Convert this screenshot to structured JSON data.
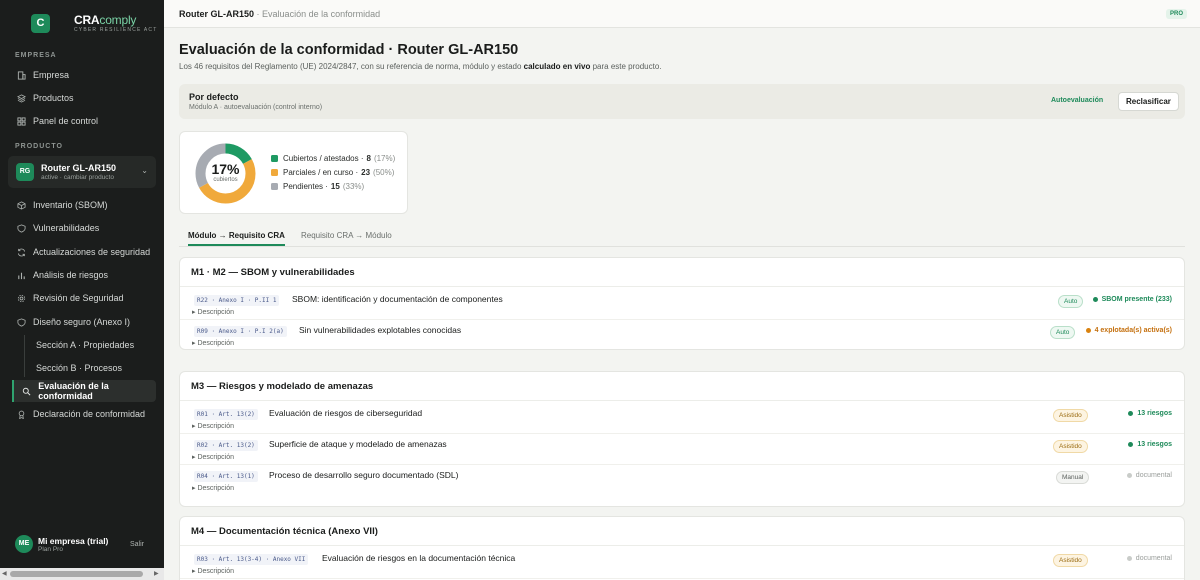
{
  "brand": {
    "logo_letter": "C",
    "name_main": "CRA",
    "name_accent": "comply",
    "tagline": "CYBER RESILIENCE ACT"
  },
  "sidebar": {
    "section_company": "EMPRESA",
    "company_items": [
      {
        "label": "Empresa",
        "icon": "building-icon"
      },
      {
        "label": "Productos",
        "icon": "layers-icon"
      },
      {
        "label": "Panel de control",
        "icon": "grid-icon"
      }
    ],
    "section_product": "PRODUCTO",
    "product": {
      "initials": "RG",
      "name": "Router GL-AR150",
      "sub": "active · cambiar producto"
    },
    "product_items": [
      {
        "label": "Inventario (SBOM)",
        "icon": "box-icon"
      },
      {
        "label": "Vulnerabilidades",
        "icon": "shield-icon"
      },
      {
        "label": "Actualizaciones de seguridad",
        "icon": "refresh-icon"
      },
      {
        "label": "Análisis de riesgos",
        "icon": "bar-chart-icon"
      },
      {
        "label": "Revisión de Seguridad",
        "icon": "gear-icon"
      },
      {
        "label": "Diseño seguro (Anexo I)",
        "icon": "shield-check-icon"
      }
    ],
    "sub_items": [
      {
        "label": "Sección A · Propiedades"
      },
      {
        "label": "Sección B · Procesos"
      }
    ],
    "active_item": {
      "label": "Evaluación de la conformidad",
      "icon": "search-icon"
    },
    "declaration_item": {
      "label": "Declaración de conformidad",
      "icon": "award-icon"
    },
    "user": {
      "initials": "ME",
      "name": "Mi empresa (trial)",
      "plan": "Plan Pro",
      "logout": "Salir"
    }
  },
  "topbar": {
    "product": "Router GL-AR150",
    "separator": "·",
    "page": "Evaluación de la conformidad",
    "badge": "PRO"
  },
  "header": {
    "title": "Evaluación de la conformidad · Router GL-AR150",
    "desc_before": "Los 46 requisitos del Reglamento (UE) 2024/2847, con su referencia de norma, módulo y estado ",
    "desc_bold": "calculado en vivo",
    "desc_after": " para este producto."
  },
  "default_bar": {
    "title": "Por defecto",
    "sub": "Módulo A · autoevaluación (control interno)",
    "mode": "Autoevaluación",
    "button": "Reclasificar"
  },
  "summary": {
    "pct": "17%",
    "pct_label": "cubiertos",
    "legend": [
      {
        "label": "Cubiertos / atestados ·",
        "count": "8",
        "pct": "(17%)",
        "color": "#1e9a63",
        "fraction": 0.17
      },
      {
        "label": "Parciales / en curso ·",
        "count": "23",
        "pct": "(50%)",
        "color": "#f0a93b",
        "fraction": 0.5
      },
      {
        "label": "Pendientes ·",
        "count": "15",
        "pct": "(33%)",
        "color": "#a7abb2",
        "fraction": 0.33
      }
    ]
  },
  "tabs": [
    {
      "label": "Módulo → Requisito CRA"
    },
    {
      "label": "Requisito CRA → Módulo"
    }
  ],
  "modules": [
    {
      "title": "M1 · M2 — SBOM y vulnerabilidades",
      "reqs": [
        {
          "ref": "R22 · Anexo I · P.II 1",
          "title": "SBOM: identificación y documentación de componentes",
          "desc": "▸ Descripción",
          "pill": "Auto",
          "status": "SBOM presente (233)"
        },
        {
          "ref": "R09 · Anexo I · P.I 2(a)",
          "title": "Sin vulnerabilidades explotables conocidas",
          "desc": "▸ Descripción",
          "pill": "Auto",
          "status": "4 explotada(s) activa(s)"
        }
      ]
    },
    {
      "title": "M3 — Riesgos y modelado de amenazas",
      "reqs": [
        {
          "ref": "R01 · Art. 13(2)",
          "title": "Evaluación de riesgos de ciberseguridad",
          "desc": "▸ Descripción",
          "pill": "Asistido",
          "status": "13 riesgos"
        },
        {
          "ref": "R02 · Art. 13(2)",
          "title": "Superficie de ataque y modelado de amenazas",
          "desc": "▸ Descripción",
          "pill": "Asistido",
          "status": "13 riesgos"
        },
        {
          "ref": "R04 · Art. 13(1)",
          "title": "Proceso de desarrollo seguro documentado (SDL)",
          "desc": "▸ Descripción",
          "pill": "Manual",
          "status": "documental"
        }
      ]
    },
    {
      "title": "M4 — Documentación técnica (Anexo VII)",
      "reqs": [
        {
          "ref": "R03 · Art. 13(3-4) · Anexo VII",
          "title": "Evaluación de riesgos en la documentación técnica",
          "desc": "▸ Descripción",
          "pill": "Asistido",
          "status": "documental"
        }
      ]
    }
  ]
}
